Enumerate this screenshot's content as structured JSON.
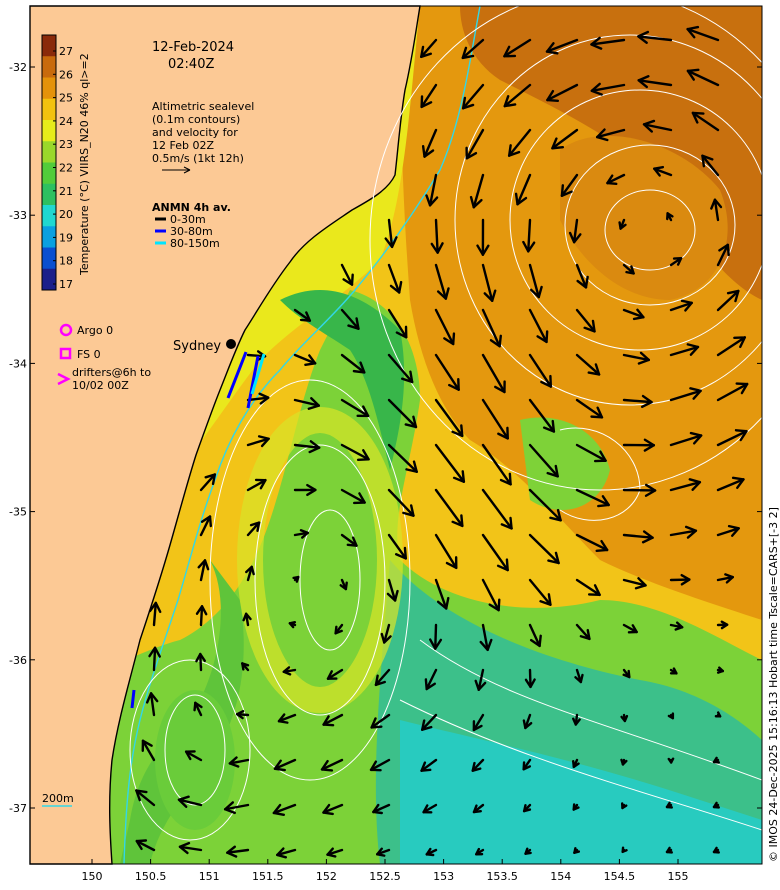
{
  "header": {
    "date": "12-Feb-2024",
    "time": "02:40Z"
  },
  "colorbar": {
    "label": "Temperature (°C) VIIRS_N20 46% ql>=2",
    "ticks": [
      "17",
      "18",
      "19",
      "20",
      "21",
      "22",
      "23",
      "24",
      "25",
      "26",
      "27"
    ],
    "colors": [
      "#1b1f8a",
      "#0a4fd0",
      "#0aa0e0",
      "#20d8d0",
      "#2ec060",
      "#52cc3a",
      "#9ad82a",
      "#e6ec1a",
      "#f2c20e",
      "#e4920a",
      "#c86a0c",
      "#8a2a0a"
    ]
  },
  "altimetry_note": {
    "lines": [
      "Altimetric sealevel",
      "(0.1m contours)",
      "and velocity for",
      "12 Feb 02Z",
      "0.5m/s (1kt 12h)"
    ]
  },
  "anmn": {
    "title": "ANMN 4h av.",
    "items": [
      {
        "label": "0-30m",
        "color": "#000000"
      },
      {
        "label": "30-80m",
        "color": "#0000ff"
      },
      {
        "label": "80-150m",
        "color": "#00e5ff"
      }
    ]
  },
  "legend": {
    "argo": "Argo 0",
    "fs": "FS 0",
    "drifters_line1": "drifters@6h to",
    "drifters_line2": "10/02 00Z",
    "marker_color": "#ff00ff"
  },
  "place": {
    "sydney": "Sydney"
  },
  "depth_label": "200m",
  "axes": {
    "x_ticks": [
      "150",
      "150.5",
      "151",
      "151.5",
      "152",
      "152.5",
      "153",
      "153.5",
      "154",
      "154.5",
      "155"
    ],
    "y_ticks": [
      "-32",
      "-33",
      "-34",
      "-35",
      "-36",
      "-37"
    ]
  },
  "credit": "© IMOS 24-Dec-2025 15:16:13 Hobart time Tscale=CARS+[-3 2]",
  "colors": {
    "land": "#fcc995",
    "coast": "#000000",
    "contour": "#ffffff",
    "isobath": "#33d7e6"
  }
}
